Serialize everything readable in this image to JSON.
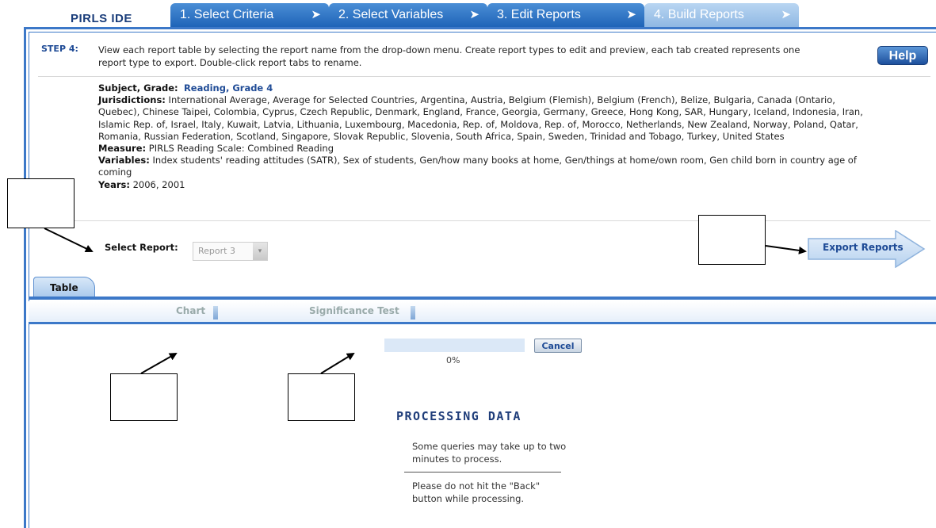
{
  "app": {
    "logo": "PIRLS IDE"
  },
  "nav_tabs": [
    {
      "label": "1.  Select Criteria",
      "arrow": "➤"
    },
    {
      "label": "2.  Select Variables",
      "arrow": "➤"
    },
    {
      "label": "3.  Edit Reports",
      "arrow": "➤"
    },
    {
      "label": "4.  Build Reports",
      "arrow": "➤"
    }
  ],
  "step": {
    "label": "STEP 4:",
    "text": "View each report table by selecting the report name from the drop-down menu. Create report types to edit and preview, each tab created represents one report type to export. Double-click report tabs to rename.",
    "help_label": "Help"
  },
  "criteria": {
    "subject_label": "Subject, Grade:",
    "subject_value": "Reading, Grade 4",
    "jurisdictions_label": "Jurisdictions:",
    "jurisdictions_value": "International Average, Average for Selected Countries, Argentina, Austria, Belgium (Flemish), Belgium (French), Belize, Bulgaria, Canada (Ontario, Quebec), Chinese Taipei, Colombia, Cyprus, Czech Republic, Denmark, England, France, Georgia, Germany, Greece, Hong Kong, SAR, Hungary, Iceland, Indonesia, Iran, Islamic Rep. of, Israel, Italy, Kuwait, Latvia, Lithuania, Luxembourg, Macedonia, Rep. of, Moldova, Rep. of, Morocco, Netherlands, New Zealand, Norway, Poland, Qatar, Romania, Russian Federation, Scotland, Singapore, Slovak Republic, Slovenia, South Africa, Spain, Sweden, Trinidad and Tobago, Turkey, United States",
    "measure_label": "Measure:",
    "measure_value": "PIRLS Reading Scale: Combined Reading",
    "variables_label": "Variables:",
    "variables_value": "Index students' reading attitudes (SATR), Sex of students, Gen/how many books at home, Gen/things at home/own room, Gen child born in country age of coming",
    "years_label": "Years:",
    "years_value": "2006, 2001"
  },
  "report_select": {
    "label": "Select Report:",
    "value": "Report 3",
    "arrow": "▾"
  },
  "export": {
    "label": "Export Reports"
  },
  "report_tabs": {
    "table": "Table",
    "chart": "Chart",
    "significance": "Significance Test"
  },
  "processing": {
    "progress_percent": 0,
    "percent_text": "0%",
    "cancel_label": "Cancel",
    "title": "PROCESSING DATA",
    "message1": "Some queries may take up to two minutes to process.",
    "message2": "Please do not hit the \"Back\" button while processing."
  }
}
